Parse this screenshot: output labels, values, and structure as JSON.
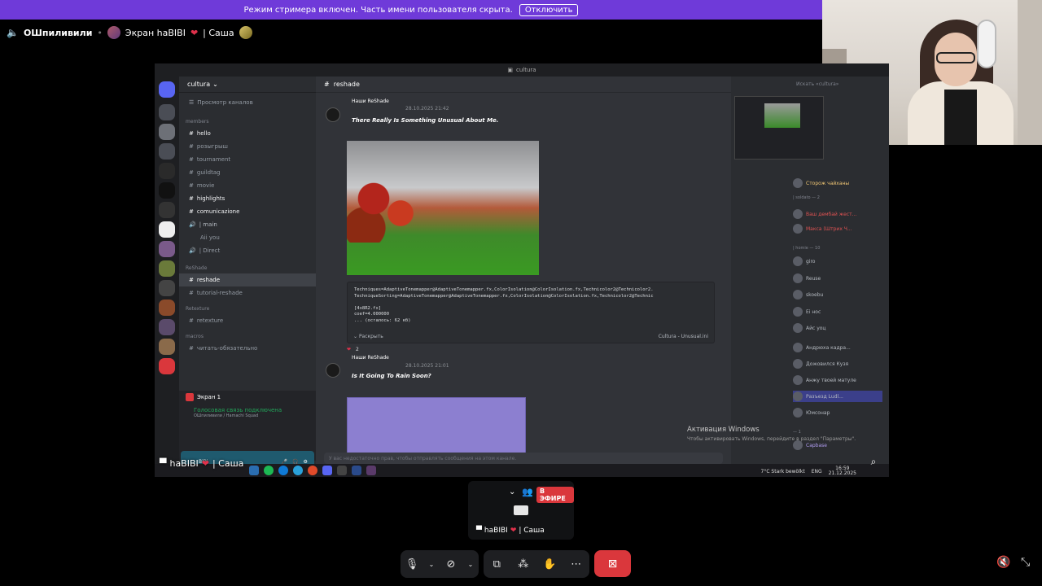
{
  "banner": {
    "text": "Режим стримера включен. Часть имени пользователя скрыта.",
    "button": "Отключить"
  },
  "header": {
    "channel": "ОШпиливили",
    "stream_label": "Экран haBIBI",
    "user_suffix": "| Саша"
  },
  "shared": {
    "server_name": "cultura",
    "browse_label": "Просмотр каналов",
    "channel_title": "reshade",
    "categories": [
      "members",
      "ReShade",
      "Retexture",
      "macros"
    ],
    "channels": [
      {
        "name": "hello",
        "bold": true
      },
      {
        "name": "розыгрыш",
        "bold": false
      },
      {
        "name": "tournament",
        "bold": false
      },
      {
        "name": "guildtag",
        "bold": false
      },
      {
        "name": "movie",
        "bold": false
      },
      {
        "name": "highlights",
        "bold": true
      },
      {
        "name": "comunicazione",
        "bold": true
      },
      {
        "name": "| main",
        "bold": false
      },
      {
        "name": "Aii you",
        "bold": false
      },
      {
        "name": "| Direct",
        "bold": false
      },
      {
        "name": "reshade",
        "bold": true
      },
      {
        "name": "tutorial-reshade",
        "bold": false
      },
      {
        "name": "retexture",
        "bold": false
      },
      {
        "name": "читать-обязательно",
        "bold": false
      }
    ],
    "voice_label": "Экран 1",
    "voice_connected": "Голосовая связь подключена",
    "voice_sub": "ОШпиливили / Hamachi Squad",
    "user_name": "BiBi",
    "msg1_name": "Наши ReShade",
    "msg1_time": "28.10.2025 21:42",
    "msg1_title": "There Really Is Something Unusual About Me.",
    "code": "Techniques=AdaptiveTonemapper@AdaptiveTonemapper.fx,ColorIsolation@ColorIsolation.fx,Technicolor2@Technicolor2.\nTechniqueSorting=AdaptiveTonemapper@AdaptiveTonemapper.fx,ColorIsolation@ColorIsolation.fx,Technicolor2@Technic\n\n[4x8R2.fx]\ncoef=4.000000\n... (осталось: 62 кб)",
    "expand": "Раскрыть",
    "file_label": "Cultura - Unusual.ini",
    "reaction_count": "2",
    "msg2_name": "Наши ReShade",
    "msg2_time": "28.10.2025 21:01",
    "msg2_title": "Is It Going To Rain Soon?",
    "input_placeholder": "У вас недостаточно прав, чтобы отправлять сообщения на этом канале.",
    "search_placeholder": "Искать «cultura»",
    "members": [
      "Сторож чайханы",
      "Ваш дембай жест...",
      "Макса (Штрих Ч...",
      "giro",
      "Reuse",
      "skoebu",
      "Ei нос",
      "Айс уоц",
      "Андрюха кадра...",
      "Дожовился Кузя",
      "Анжу твоей матуле",
      "Разъезд Ludl...",
      "Юмсонар",
      "Capbase"
    ],
    "member_cats": [
      "| soldato — 2",
      "| homie — 10",
      "— 1"
    ],
    "activation_title": "Активация Windows",
    "activation_sub": "Чтобы активировать Windows, перейдите в раздел \"Параметры\".",
    "weather": "7°C  Stark bewölkt",
    "lang": "ENG",
    "clock": "16:59",
    "date": "21.12.2025",
    "share_label": "haBIBI",
    "share_suffix": "| Саша"
  },
  "tile": {
    "live": "В ЭФИРЕ",
    "name": "haBIBI",
    "suffix": "| Саша"
  },
  "colors": {
    "banner": "#6f3ad9",
    "end_call": "#da373c",
    "live": "#da373c"
  }
}
